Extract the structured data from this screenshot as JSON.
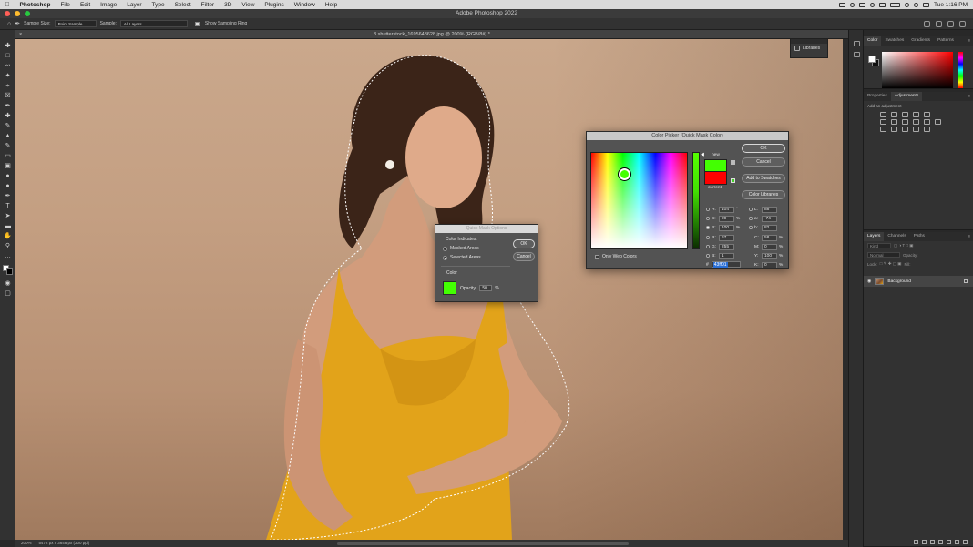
{
  "menubar": {
    "app": "Photoshop",
    "items": [
      "File",
      "Edit",
      "Image",
      "Layer",
      "Type",
      "Select",
      "Filter",
      "3D",
      "View",
      "Plugins",
      "Window",
      "Help"
    ],
    "clock": "Tue 1:16 PM"
  },
  "window": {
    "title": "Adobe Photoshop 2022",
    "doc_tab": "3 shutterstock_1695648628.jpg @ 200% (RGB/8#) *"
  },
  "options_bar": {
    "sample_size_label": "Sample Size:",
    "sample_size_value": "Point Sample",
    "sample_label": "Sample:",
    "sample_value": "All Layers",
    "show_ring_label": "Show Sampling Ring"
  },
  "status_bar": {
    "zoom": "200%",
    "doc_info": "5472 px x 3648 px (300 ppi)"
  },
  "libraries_panel": {
    "label": "Libraries"
  },
  "color_panel": {
    "tabs": [
      "Color",
      "Swatches",
      "Gradients",
      "Patterns"
    ]
  },
  "adjustments_panel": {
    "tabs": [
      "Properties",
      "Adjustments"
    ],
    "hint": "Add an adjustment"
  },
  "layers_panel": {
    "tabs": [
      "Layers",
      "Channels",
      "Paths"
    ],
    "search_placeholder": "Kind",
    "blend_mode": "Normal",
    "opacity_label": "Opacity:",
    "lock_label": "Lock:",
    "fill_label": "Fill:",
    "layer_name": "Background"
  },
  "quick_mask": {
    "title": "Quick Mask Options",
    "color_indicates": "Color Indicates:",
    "masked_areas": "Masked Areas",
    "selected_areas": "Selected Areas",
    "color_label": "Color",
    "opacity_label": "Opacity:",
    "opacity_value": "50",
    "opacity_unit": "%",
    "ok": "OK",
    "cancel": "Cancel",
    "swatch_color": "#43ff02"
  },
  "color_picker": {
    "title": "Color Picker (Quick Mask Color)",
    "ok": "OK",
    "cancel": "Cancel",
    "add_to_swatches": "Add to Swatches",
    "color_libraries": "Color Libraries",
    "new_label": "new",
    "current_label": "current",
    "new_color": "#43ff02",
    "current_color": "#ff0000",
    "only_web_colors": "Only Web Colors",
    "H": "104",
    "H_unit": "°",
    "S": "99",
    "S_unit": "%",
    "B": "100",
    "B_unit": "%",
    "R": "67",
    "G": "255",
    "Bv": "1",
    "L": "88",
    "a": "-74",
    "b": "82",
    "C": "58",
    "C_unit": "%",
    "M": "0",
    "M_unit": "%",
    "Y": "100",
    "Y_unit": "%",
    "K": "0",
    "K_unit": "%",
    "hex_label": "#",
    "hex": "43ff01"
  }
}
